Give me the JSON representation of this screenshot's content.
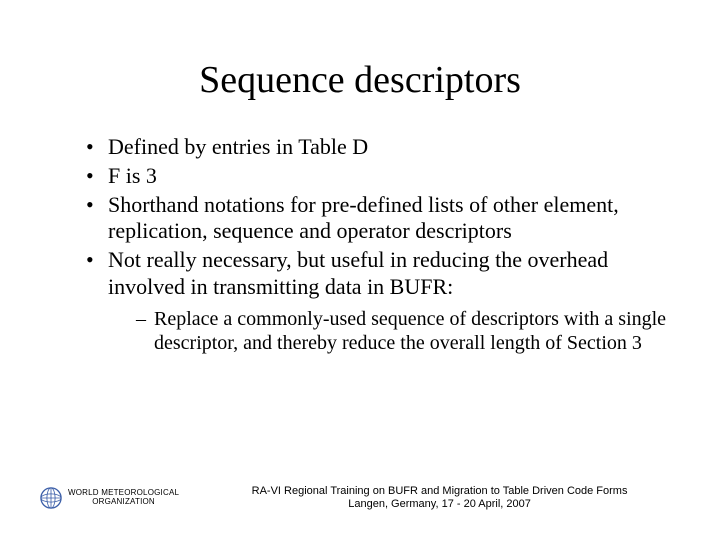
{
  "title": "Sequence descriptors",
  "bullets": [
    "Defined by entries in Table D",
    "F is 3",
    "Shorthand notations for pre-defined lists of other element, replication, sequence and operator descriptors",
    "Not really necessary, but useful in reducing the overhead involved in transmitting data in BUFR:"
  ],
  "sub_bullets": [
    "Replace a commonly-used sequence of descriptors with a single descriptor, and thereby reduce the overall length of Section 3"
  ],
  "footer": {
    "org_line1": "WORLD METEOROLOGICAL",
    "org_line2": "ORGANIZATION",
    "event_line1": "RA-VI Regional Training on BUFR and Migration to Table Driven Code Forms",
    "event_line2": "Langen, Germany, 17 - 20 April, 2007"
  }
}
